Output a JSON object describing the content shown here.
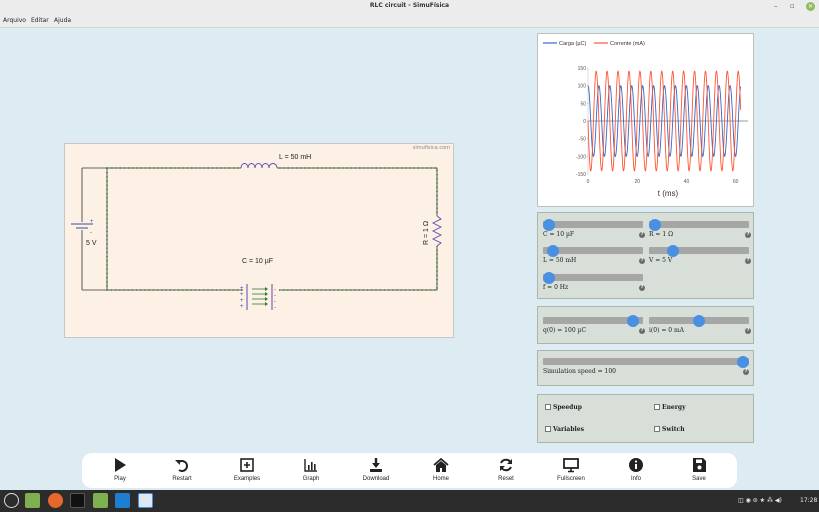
{
  "window": {
    "title": "RLC circuit - SimuFísica"
  },
  "menu": [
    "Arquivo",
    "Editar",
    "Ajuda"
  ],
  "circuit": {
    "brand": "simufisica.com",
    "inductor_label": "L = 50 mH",
    "resistor_label": "R = 1 Ω",
    "capacitor_label": "C = 10 µF",
    "source_label": "5 V"
  },
  "graph": {
    "legend_charge": "Carga (µC)",
    "legend_current": "Corrente (mA)",
    "xlabel": "t (ms)",
    "charge_color": "#3366cc",
    "current_color": "#ff5533"
  },
  "chart_data": {
    "type": "line",
    "title": "",
    "xlabel": "t (ms)",
    "ylabel": "",
    "xlim": [
      0,
      65
    ],
    "ylim": [
      -150,
      150
    ],
    "xticks": [
      0,
      20,
      40,
      60
    ],
    "yticks": [
      150,
      100,
      50,
      0,
      -50,
      -100,
      -150
    ],
    "series": [
      {
        "name": "Carga (µC)",
        "color": "#3366cc",
        "amplitude": 100,
        "period_ms": 4.44,
        "phase": "cos"
      },
      {
        "name": "Corrente (mA)",
        "color": "#ff5533",
        "amplitude": 141,
        "period_ms": 4.44,
        "phase": "-sin"
      }
    ]
  },
  "controls": {
    "c": {
      "label": "C = 10 µF",
      "fraction": 0.0
    },
    "r": {
      "label": "R = 1 Ω",
      "fraction": 0.0
    },
    "l": {
      "label": "L = 50 mH",
      "fraction": 0.05
    },
    "v": {
      "label": "V = 5 V",
      "fraction": 0.2
    },
    "f": {
      "label": "f = 0 Hz",
      "fraction": 0.0
    },
    "q0": {
      "label": "q(0) = 100 µC",
      "fraction": 0.95
    },
    "i0": {
      "label": "i(0) = 0 mA",
      "fraction": 0.5
    },
    "speed": {
      "label": "Simulation speed = 100",
      "fraction": 1.0
    }
  },
  "options": [
    "Speedup",
    "Energy",
    "Variables",
    "Switch"
  ],
  "toolbar": [
    "Play",
    "Restart",
    "Examples",
    "Graph",
    "Download",
    "Home",
    "Reset",
    "Fullscreen",
    "Info",
    "Save"
  ],
  "taskbar": {
    "clock": "17:28"
  }
}
